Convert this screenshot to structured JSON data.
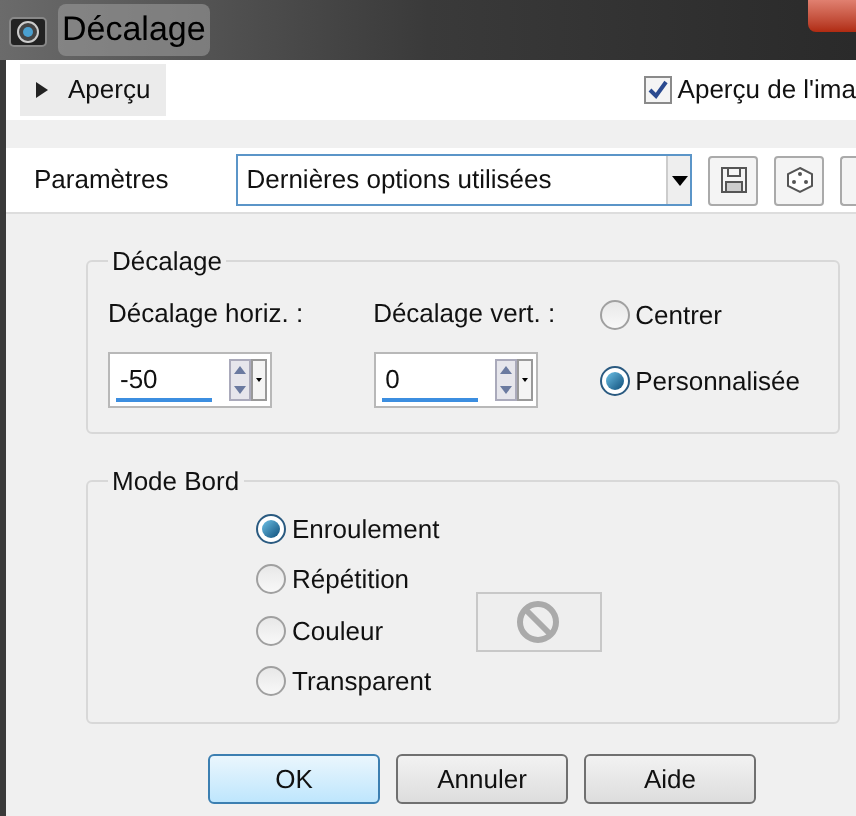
{
  "window": {
    "title": "Décalage"
  },
  "preview_bar": {
    "toggle": {
      "label": "Aperçu",
      "expanded": false
    },
    "image_preview": {
      "label": "Aperçu de l'ima",
      "checked": true
    }
  },
  "presets": {
    "label": "Paramètres",
    "value": "Dernières options utilisées"
  },
  "offset_group": {
    "title": "Décalage",
    "fields": [
      {
        "label": "Décalage horiz. :",
        "value": "-50"
      },
      {
        "label": "Décalage vert. :",
        "value": "0"
      }
    ],
    "options": [
      {
        "label": "Centrer",
        "selected": false
      },
      {
        "label": "Personnalisée",
        "selected": true
      }
    ]
  },
  "edge_mode_group": {
    "title": "Mode Bord",
    "options": [
      {
        "label": "Enroulement",
        "selected": true
      },
      {
        "label": "Répétition",
        "selected": false
      },
      {
        "label": "Couleur",
        "selected": false
      },
      {
        "label": "Transparent",
        "selected": false
      }
    ]
  },
  "buttons": [
    {
      "label": "OK",
      "default": true
    },
    {
      "label": "Annuler",
      "default": false
    },
    {
      "label": "Aide",
      "default": false
    }
  ]
}
